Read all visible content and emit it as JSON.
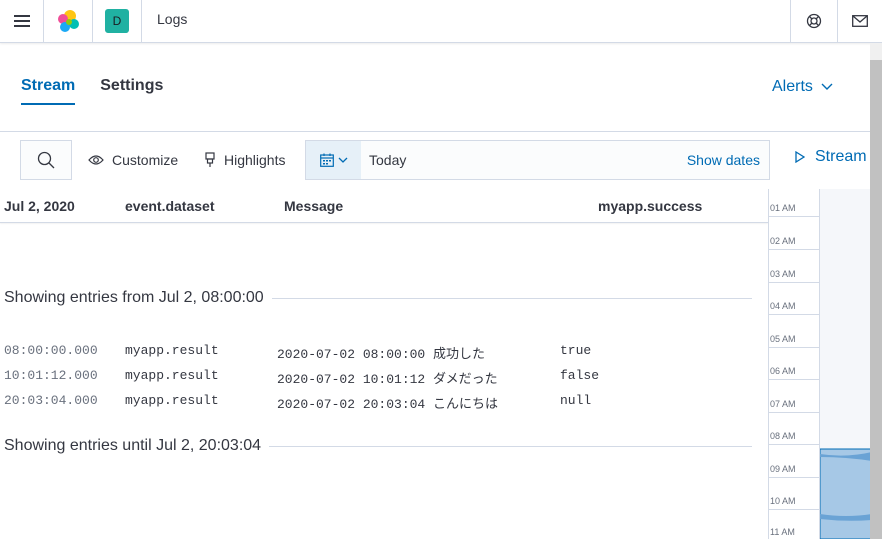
{
  "header": {
    "breadcrumb": "Logs",
    "avatar_initial": "D",
    "icons": [
      "menu-icon",
      "elastic-logo",
      "help-icon",
      "mail-icon"
    ]
  },
  "tabs": [
    {
      "label": "Stream",
      "active": true
    },
    {
      "label": "Settings",
      "active": false
    }
  ],
  "alerts_label": "Alerts",
  "toolbar": {
    "customize_label": "Customize",
    "highlights_label": "Highlights",
    "date_value": "Today",
    "show_dates_label": "Show dates",
    "stream_label": "Stream"
  },
  "columns": {
    "date": "Jul 2, 2020",
    "dataset": "event.dataset",
    "message": "Message",
    "success": "myapp.success"
  },
  "showing_from": "Showing entries from Jul 2, 08:00:00",
  "showing_until": "Showing entries until Jul 2, 20:03:04",
  "rows": [
    {
      "time": "08:00:00.000",
      "dataset": "myapp.result",
      "message_ts": "2020-07-02 08:00:00",
      "message_text": "成功した",
      "success": "true"
    },
    {
      "time": "10:01:12.000",
      "dataset": "myapp.result",
      "message_ts": "2020-07-02 10:01:12",
      "message_text": "ダメだった",
      "success": "false"
    },
    {
      "time": "20:03:04.000",
      "dataset": "myapp.result",
      "message_ts": "2020-07-02 20:03:04",
      "message_text": "こんにちは",
      "success": "null"
    }
  ],
  "minimap_ticks": [
    "01 AM",
    "02 AM",
    "03 AM",
    "04 AM",
    "05 AM",
    "06 AM",
    "07 AM",
    "08 AM",
    "09 AM",
    "10 AM",
    "11 AM"
  ],
  "colors": {
    "accent": "#006bb4",
    "avatar": "#20b1a2",
    "minimap_highlight": "#a6c8e6"
  }
}
